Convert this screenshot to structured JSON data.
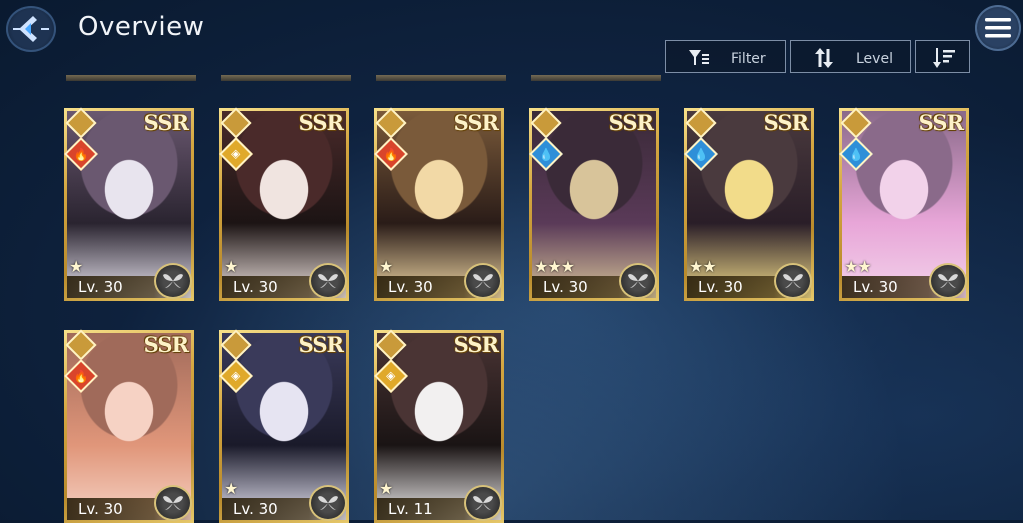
{
  "header": {
    "title": "Overview",
    "filter_label": "Filter",
    "sort_label": "Level"
  },
  "cards": [
    {
      "rarity": "SSR",
      "level": "Lv. 30",
      "element": "fire",
      "stars": "★",
      "palette": [
        "#6a5870",
        "#e8e4ee",
        "#2a2430"
      ]
    },
    {
      "rarity": "SSR",
      "level": "Lv. 30",
      "element": "light",
      "stars": "★",
      "palette": [
        "#4a2a2a",
        "#f0e4e0",
        "#1c1414"
      ]
    },
    {
      "rarity": "SSR",
      "level": "Lv. 30",
      "element": "fire",
      "stars": "★",
      "palette": [
        "#7a5a3a",
        "#f2d9a6",
        "#2a1c18"
      ]
    },
    {
      "rarity": "SSR",
      "level": "Lv. 30",
      "element": "water",
      "stars": "★★★",
      "palette": [
        "#3a2a38",
        "#d8c49a",
        "#5a3a58"
      ]
    },
    {
      "rarity": "SSR",
      "level": "Lv. 30",
      "element": "water",
      "stars": "★★",
      "palette": [
        "#4a3a3e",
        "#f2dc8a",
        "#2a1e28"
      ]
    },
    {
      "rarity": "SSR",
      "level": "Lv. 30",
      "element": "water",
      "stars": "★★",
      "palette": [
        "#8a6a8a",
        "#f2d2ea",
        "#e8a6d8"
      ]
    },
    {
      "rarity": "SSR",
      "level": "Lv. 30",
      "element": "fire",
      "stars": "",
      "palette": [
        "#a06a5a",
        "#f6d2c4",
        "#e0967a"
      ]
    },
    {
      "rarity": "SSR",
      "level": "Lv. 30",
      "element": "light",
      "stars": "★",
      "palette": [
        "#3a3a5a",
        "#e6e4f2",
        "#1a1a2a"
      ]
    },
    {
      "rarity": "SSR",
      "level": "Lv. 11",
      "element": "light",
      "stars": "★",
      "palette": [
        "#4a3434",
        "#f2f0f0",
        "#1a1414"
      ]
    }
  ],
  "colors": {
    "fire": "#d9452b",
    "water": "#2e8fd8",
    "light": "#e0a92a"
  },
  "icons": {
    "back": "back-arrow-icon",
    "menu": "hamburger-menu-icon",
    "filter": "filter-icon",
    "sort": "sort-arrows-icon",
    "order": "descending-order-icon",
    "class": "class-diamond-icon",
    "badge": "wing-emblem-icon"
  }
}
